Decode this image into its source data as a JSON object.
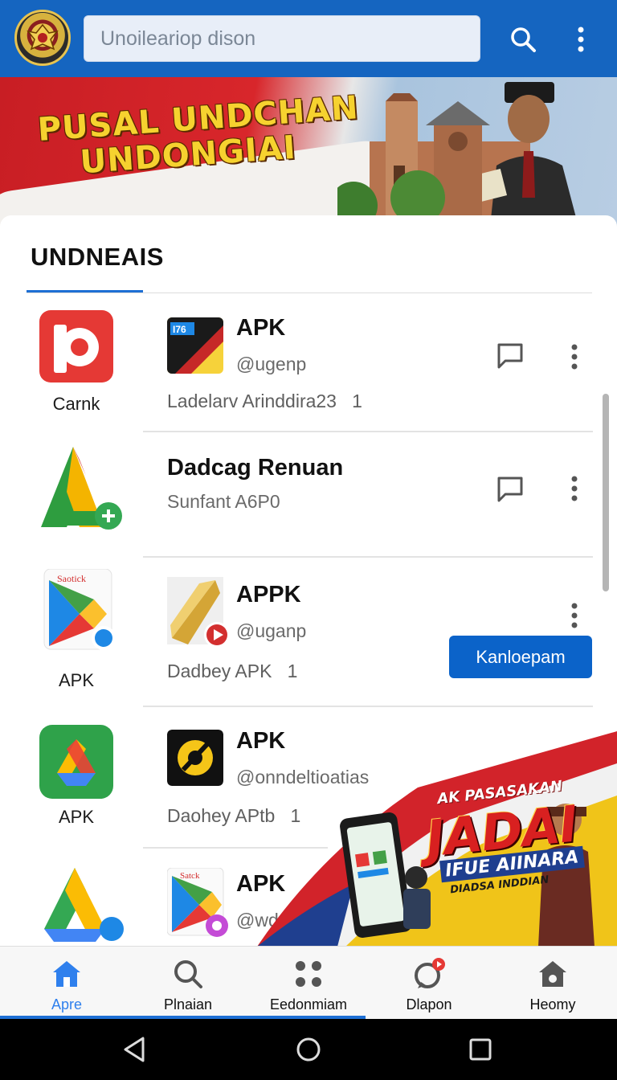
{
  "header": {
    "search_placeholder": "Unoilеariop dison",
    "search_icon": "search-icon",
    "more_icon": "more-vert-icon"
  },
  "banner": {
    "title_line1": "PUSAL UNDCHAN",
    "title_line2": "UNDONGIAI"
  },
  "section": {
    "title": "UNDNEAIS"
  },
  "left_apps": [
    {
      "label": "Carnk",
      "icon": "red-p-app-icon"
    },
    {
      "label": "",
      "icon": "green-a-app-icon"
    },
    {
      "label": "APK",
      "icon": "play-store-icon",
      "icon_text": "Saotick"
    },
    {
      "label": "APK",
      "icon": "drive-icon"
    },
    {
      "label": "",
      "icon": "drive-blue-icon"
    }
  ],
  "items": [
    {
      "title": "APK",
      "subtitle": "@ugenp",
      "meta": "Ladelarv Arinddira23",
      "count": "1",
      "thumb_text": "I76"
    },
    {
      "title": "Dadcag Renuan",
      "subtitle": "Sunfant A6P0"
    },
    {
      "title": "APPK",
      "subtitle": "@uganp",
      "meta": "Dadbey APK",
      "count": "1",
      "button": "Kanlоepam"
    },
    {
      "title": "APK",
      "subtitle": "@onndeltioatias",
      "meta": "Daohey APtb",
      "count": "1"
    },
    {
      "title": "APK",
      "subtitle": "@wdarpv",
      "thumb_text": "Satck"
    }
  ],
  "promo": {
    "line1": "AK PASASAKAN",
    "big": "JADAI",
    "line2": "IFUE AIINARA",
    "line3": "DIADSA INDDIAN"
  },
  "bottom_nav": [
    {
      "label": "Apre",
      "icon": "home-icon",
      "active": true
    },
    {
      "label": "Plnаian",
      "icon": "search-icon"
    },
    {
      "label": "Eedonmiam",
      "icon": "grid-icon"
    },
    {
      "label": "Dlapon",
      "icon": "notification-icon"
    },
    {
      "label": "Heomy",
      "icon": "home-outline-icon"
    }
  ],
  "colors": {
    "app_bar": "#1565c0",
    "accent": "#1e6fd4",
    "button": "#0b63c9"
  }
}
